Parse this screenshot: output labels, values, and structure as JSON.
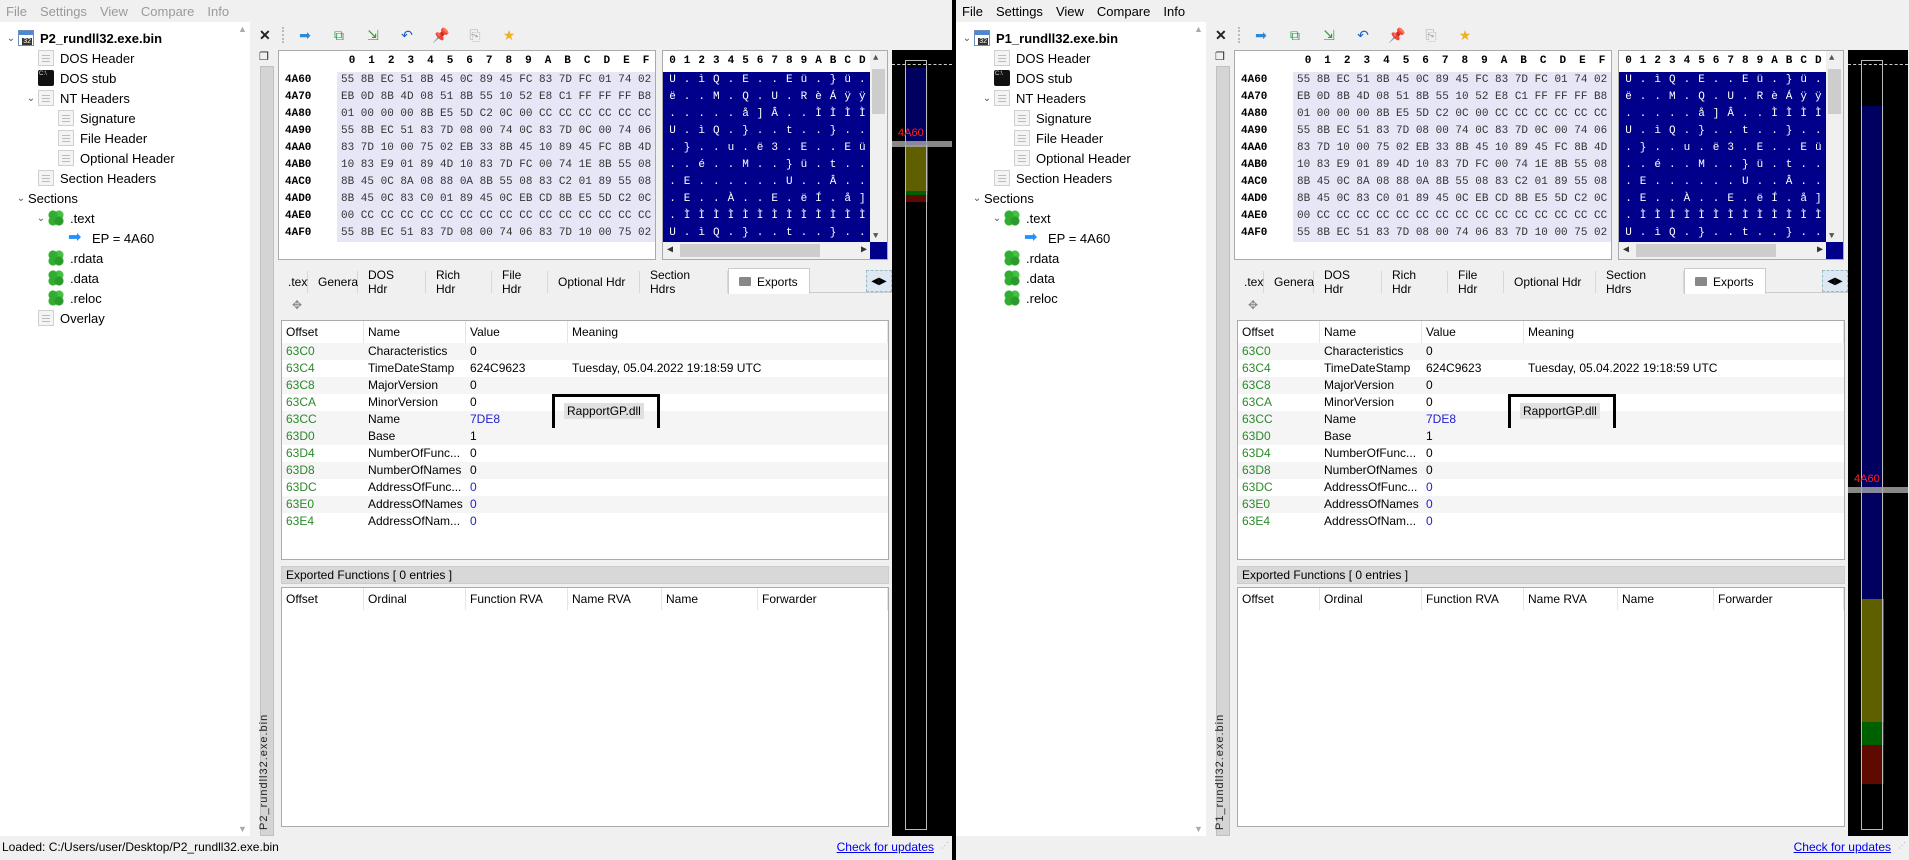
{
  "menu": [
    "File",
    "Settings",
    "View",
    "Compare",
    "Info"
  ],
  "toolbar_icons": [
    "forward-arrow-icon",
    "open-window-icon",
    "import-icon",
    "undo-icon",
    "pin-icon",
    "copy-icon",
    "favorite-star-icon"
  ],
  "hex": {
    "columns": [
      "0",
      "1",
      "2",
      "3",
      "4",
      "5",
      "6",
      "7",
      "8",
      "9",
      "A",
      "B",
      "C",
      "D",
      "E",
      "F"
    ],
    "ascii_columns": [
      "0",
      "1",
      "2",
      "3",
      "4",
      "5",
      "6",
      "7",
      "8",
      "9",
      "A",
      "B",
      "C",
      "D"
    ],
    "rows": [
      {
        "addr": "4A60",
        "bytes": "55 8B EC 51 8B 45 0C 89 45 FC 83 7D FC 01 74 02",
        "ascii": [
          "U",
          ".",
          "ì",
          "Q",
          ".",
          "E",
          ".",
          ".",
          "E",
          "ü",
          ".",
          "}",
          "ü",
          "."
        ]
      },
      {
        "addr": "4A70",
        "bytes": "EB 0D 8B 4D 08 51 8B 55 10 52 E8 C1 FF FF FF B8",
        "ascii": [
          "ë",
          ".",
          ".",
          "M",
          ".",
          "Q",
          ".",
          "U",
          ".",
          "R",
          "è",
          "Á",
          "ÿ",
          "ÿ"
        ]
      },
      {
        "addr": "4A80",
        "bytes": "01 00 00 00 8B E5 5D C2 0C 00 CC CC CC CC CC CC",
        "ascii": [
          ".",
          ".",
          ".",
          ".",
          ".",
          "å",
          "]",
          "Â",
          ".",
          ".",
          "Ì",
          "Ì",
          "Ì",
          "Ì"
        ]
      },
      {
        "addr": "4A90",
        "bytes": "55 8B EC 51 83 7D 08 00 74 0C 83 7D 0C 00 74 06",
        "ascii": [
          "U",
          ".",
          "ì",
          "Q",
          ".",
          "}",
          ".",
          ".",
          "t",
          ".",
          ".",
          "}",
          ".",
          "."
        ]
      },
      {
        "addr": "4AA0",
        "bytes": "83 7D 10 00 75 02 EB 33 8B 45 10 89 45 FC 8B 4D",
        "ascii": [
          ".",
          "}",
          ".",
          ".",
          "u",
          ".",
          "ë",
          "3",
          ".",
          "E",
          ".",
          ".",
          "E",
          "ü"
        ]
      },
      {
        "addr": "4AB0",
        "bytes": "10 83 E9 01 89 4D 10 83 7D FC 00 74 1E 8B 55 08",
        "ascii": [
          ".",
          ".",
          "é",
          ".",
          ".",
          "M",
          ".",
          ".",
          "}",
          "ü",
          ".",
          "t",
          ".",
          "."
        ]
      },
      {
        "addr": "4AC0",
        "bytes": "8B 45 0C 8A 08 88 0A 8B 55 08 83 C2 01 89 55 08",
        "ascii": [
          ".",
          "E",
          ".",
          ".",
          ".",
          ".",
          ".",
          ".",
          "U",
          ".",
          ".",
          "Â",
          ".",
          "."
        ]
      },
      {
        "addr": "4AD0",
        "bytes": "8B 45 0C 83 C0 01 89 45 0C EB CD 8B E5 5D C2 0C",
        "ascii": [
          ".",
          "E",
          ".",
          ".",
          "À",
          ".",
          ".",
          "E",
          ".",
          "ë",
          "Í",
          ".",
          "å",
          "]"
        ]
      },
      {
        "addr": "4AE0",
        "bytes": "00 CC CC CC CC CC CC CC CC CC CC CC CC CC CC CC",
        "ascii": [
          ".",
          "Ì",
          "Ì",
          "Ì",
          "Ì",
          "Ì",
          "Ì",
          "Ì",
          "Ì",
          "Ì",
          "Ì",
          "Ì",
          "Ì",
          "Ì"
        ]
      },
      {
        "addr": "4AF0",
        "bytes": "55 8B EC 51 83 7D 08 00 74 06 83 7D 10 00 75 02",
        "ascii": [
          "U",
          ".",
          "ì",
          "Q",
          ".",
          "}",
          ".",
          ".",
          "t",
          ".",
          ".",
          "}",
          ".",
          "."
        ]
      }
    ]
  },
  "overview": {
    "marker_label": "4A60",
    "colors": {
      "code": "#00005f",
      "rdata": "#5f5f00",
      "data": "#006000",
      "reloc": "#5f0a00"
    }
  },
  "tabs": [
    ".text",
    "General",
    "DOS Hdr",
    "Rich Hdr",
    "File Hdr",
    "Optional Hdr",
    "Section Hdrs",
    "Exports"
  ],
  "active_tab": "Exports",
  "export_dir": {
    "headers": [
      "Offset",
      "Name",
      "Value",
      "Meaning"
    ],
    "rows": [
      {
        "offset": "63C0",
        "name": "Characteristics",
        "value": "0",
        "meaning": "",
        "value_link": false
      },
      {
        "offset": "63C4",
        "name": "TimeDateStamp",
        "value": "624C9623",
        "meaning": "Tuesday, 05.04.2022 19:18:59 UTC",
        "value_link": false
      },
      {
        "offset": "63C8",
        "name": "MajorVersion",
        "value": "0",
        "meaning": "",
        "value_link": false
      },
      {
        "offset": "63CA",
        "name": "MinorVersion",
        "value": "0",
        "meaning": "",
        "value_link": false
      },
      {
        "offset": "63CC",
        "name": "Name",
        "value": "7DE8",
        "meaning": "RapportGP.dll",
        "value_link": true
      },
      {
        "offset": "63D0",
        "name": "Base",
        "value": "1",
        "meaning": "",
        "value_link": false
      },
      {
        "offset": "63D4",
        "name": "NumberOfFunc...",
        "value": "0",
        "meaning": "",
        "value_link": false
      },
      {
        "offset": "63D8",
        "name": "NumberOfNames",
        "value": "0",
        "meaning": "",
        "value_link": false
      },
      {
        "offset": "63DC",
        "name": "AddressOfFunc...",
        "value": "0",
        "meaning": "",
        "value_link": true
      },
      {
        "offset": "63E0",
        "name": "AddressOfNames",
        "value": "0",
        "meaning": "",
        "value_link": true
      },
      {
        "offset": "63E4",
        "name": "AddressOfNam...",
        "value": "0",
        "meaning": "",
        "value_link": true
      }
    ]
  },
  "exported_functions": {
    "title": "Exported Functions   [ 0 entries ]",
    "headers": [
      "Offset",
      "Ordinal",
      "Function RVA",
      "Name RVA",
      "Name",
      "Forwarder"
    ]
  },
  "left": {
    "file": "P2_rundll32.exe.bin",
    "tree": [
      {
        "label": "P2_rundll32.exe.bin",
        "level": 0,
        "icon": "exe",
        "chevron": true,
        "bold": true
      },
      {
        "label": "DOS Header",
        "level": 1,
        "icon": "doc"
      },
      {
        "label": "DOS stub",
        "level": 1,
        "icon": "stub"
      },
      {
        "label": "NT Headers",
        "level": 1,
        "icon": "doc",
        "chevron": true
      },
      {
        "label": "Signature",
        "level": 2,
        "icon": "doc"
      },
      {
        "label": "File Header",
        "level": 2,
        "icon": "doc"
      },
      {
        "label": "Optional Header",
        "level": 2,
        "icon": "doc"
      },
      {
        "label": "Section Headers",
        "level": 1,
        "icon": "doc"
      },
      {
        "label": "Sections",
        "level": 0.5,
        "icon": "",
        "chevron": true
      },
      {
        "label": ".text",
        "level": 1.5,
        "icon": "puz",
        "chevron": true
      },
      {
        "label": "EP = 4A60",
        "level": 2.5,
        "icon": "arrow"
      },
      {
        "label": ".rdata",
        "level": 1.5,
        "icon": "puz"
      },
      {
        "label": ".data",
        "level": 1.5,
        "icon": "puz"
      },
      {
        "label": ".reloc",
        "level": 1.5,
        "icon": "puz"
      },
      {
        "label": "Overlay",
        "level": 1,
        "icon": "doc"
      }
    ],
    "status": "Loaded: C:/Users/user/Desktop/P2_rundll32.exe.bin",
    "update_link": "Check for updates"
  },
  "right": {
    "file": "P1_rundll32.exe.bin",
    "tree": [
      {
        "label": "P1_rundll32.exe.bin",
        "level": 0,
        "icon": "exe",
        "chevron": true,
        "bold": true
      },
      {
        "label": "DOS Header",
        "level": 1,
        "icon": "doc"
      },
      {
        "label": "DOS stub",
        "level": 1,
        "icon": "stub"
      },
      {
        "label": "NT Headers",
        "level": 1,
        "icon": "doc",
        "chevron": true
      },
      {
        "label": "Signature",
        "level": 2,
        "icon": "doc"
      },
      {
        "label": "File Header",
        "level": 2,
        "icon": "doc"
      },
      {
        "label": "Optional Header",
        "level": 2,
        "icon": "doc"
      },
      {
        "label": "Section Headers",
        "level": 1,
        "icon": "doc"
      },
      {
        "label": "Sections",
        "level": 0.5,
        "icon": "",
        "chevron": true
      },
      {
        "label": ".text",
        "level": 1.5,
        "icon": "puz",
        "chevron": true
      },
      {
        "label": "EP = 4A60",
        "level": 2.5,
        "icon": "arrow"
      },
      {
        "label": ".rdata",
        "level": 1.5,
        "icon": "puz"
      },
      {
        "label": ".data",
        "level": 1.5,
        "icon": "puz"
      },
      {
        "label": ".reloc",
        "level": 1.5,
        "icon": "puz"
      }
    ],
    "status": "",
    "update_link": "Check for updates"
  }
}
